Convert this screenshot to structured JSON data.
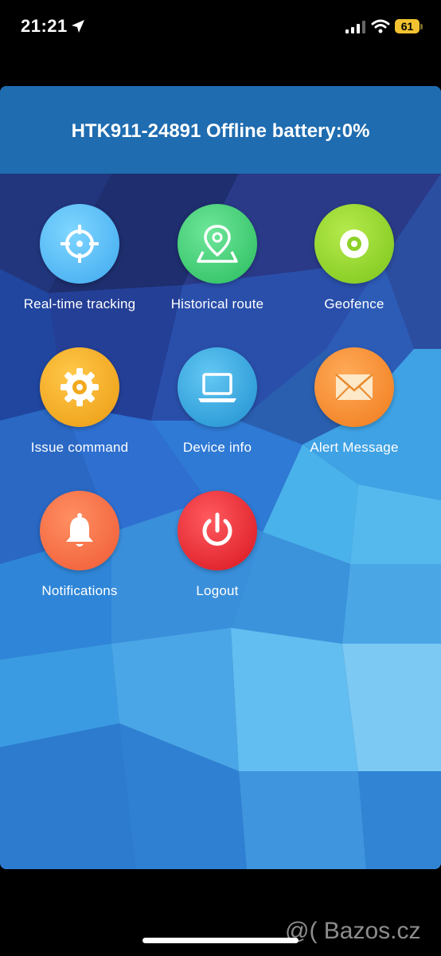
{
  "status_bar": {
    "time": "21:21",
    "battery_level": "61",
    "icons": [
      "location-arrow-icon",
      "cellular-signal-icon",
      "wifi-icon",
      "battery-icon"
    ]
  },
  "header": {
    "title": "HTK911-24891 Offline battery:0%"
  },
  "menu": [
    {
      "label": "Real-time tracking",
      "icon": "crosshair-icon",
      "color": "#52b9f2"
    },
    {
      "label": "Historical route",
      "icon": "map-pin-icon",
      "color": "#3fcf72"
    },
    {
      "label": "Geofence",
      "icon": "target-disc-icon",
      "color": "#8ed12a"
    },
    {
      "label": "Issue command",
      "icon": "gear-icon",
      "color": "#f2a91e"
    },
    {
      "label": "Device info",
      "icon": "laptop-icon",
      "color": "#2fa7e0"
    },
    {
      "label": "Alert Message",
      "icon": "envelope-icon",
      "color": "#f98d2b"
    },
    {
      "label": "Notifications",
      "icon": "bell-icon",
      "color": "#f66e45"
    },
    {
      "label": "Logout",
      "icon": "power-icon",
      "color": "#ee2a33"
    }
  ],
  "watermark": "@( Bazos.cz"
}
